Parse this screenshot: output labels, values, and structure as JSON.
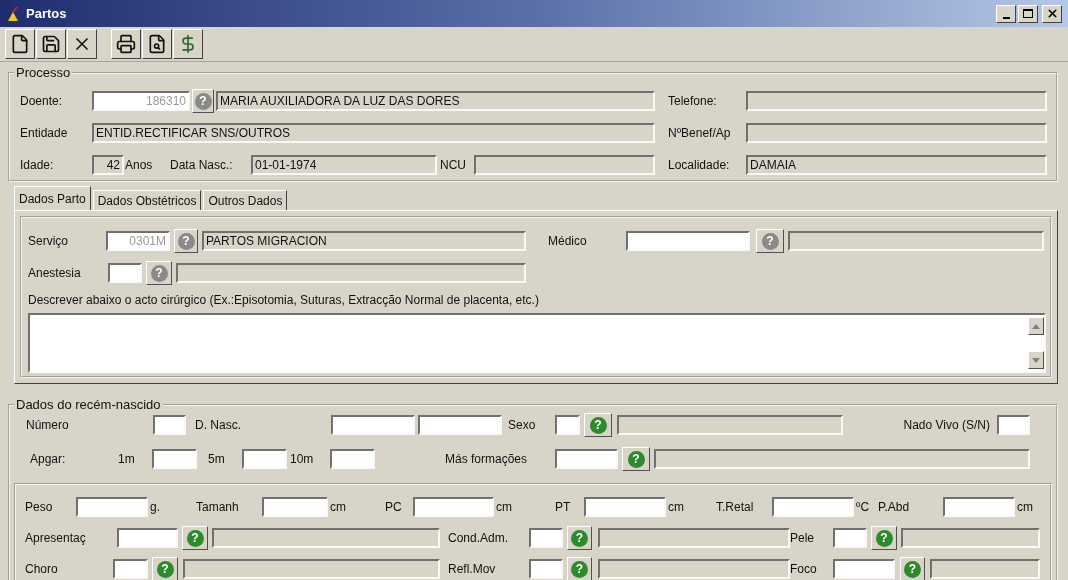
{
  "window": {
    "title": "Partos"
  },
  "toolbar": [
    {
      "kind": "new"
    },
    {
      "kind": "save"
    },
    {
      "kind": "delete"
    },
    {
      "kind": "print"
    },
    {
      "kind": "preview"
    },
    {
      "kind": "currency"
    }
  ],
  "processo": {
    "title": "Processo",
    "fields": [
      {
        "kind": "label",
        "text": "Doente:"
      },
      {
        "kind": "input",
        "value": "186310",
        "disabled": true
      },
      {
        "kind": "lookup",
        "symbol": "?",
        "disabled": true
      },
      {
        "kind": "display",
        "value": "MARIA AUXILIADORA DA LUZ DAS DORES"
      },
      {
        "kind": "label",
        "text": "Telefone:"
      },
      {
        "kind": "display"
      },
      {
        "kind": "label",
        "text": "Entidade"
      },
      {
        "kind": "display",
        "value": "ENTID.RECTIFICAR SNS/OUTROS"
      },
      {
        "kind": "label",
        "text": "NºBenef/Ap"
      },
      {
        "kind": "display"
      },
      {
        "kind": "label",
        "text": "Idade:"
      },
      {
        "kind": "display",
        "value": "42"
      },
      {
        "kind": "label",
        "text": "Anos"
      },
      {
        "kind": "label",
        "text": "Data Nasc.:"
      },
      {
        "kind": "display",
        "value": "01-01-1974"
      },
      {
        "kind": "label",
        "text": "NCU"
      },
      {
        "kind": "display"
      },
      {
        "kind": "label",
        "text": "Localidade:"
      },
      {
        "kind": "display",
        "value": "DAMAIA"
      }
    ]
  },
  "tabs": [
    {
      "label": "Dados Parto",
      "selected": true
    },
    {
      "label": "Dados Obstétricos",
      "selected": false
    },
    {
      "label": "Outros Dados",
      "selected": false
    }
  ],
  "tab_panel": {
    "fields": [
      {
        "kind": "label",
        "text": "Serviço"
      },
      {
        "kind": "input",
        "value": "0301M",
        "disabled": true
      },
      {
        "kind": "lookup",
        "symbol": "?",
        "disabled": true
      },
      {
        "kind": "display",
        "value": "PARTOS MIGRACION"
      },
      {
        "kind": "label",
        "text": "Médico"
      },
      {
        "kind": "input"
      },
      {
        "kind": "lookup",
        "symbol": "?",
        "disabled": true
      },
      {
        "kind": "display"
      },
      {
        "kind": "label",
        "text": "Anestesia"
      },
      {
        "kind": "input"
      },
      {
        "kind": "lookup",
        "symbol": "?",
        "disabled": true
      },
      {
        "kind": "display"
      }
    ],
    "note": "Descrever abaixo o acto cirúrgico (Ex.:Episotomia, Suturas, Extracção Normal de placenta, etc.)"
  },
  "newborn": {
    "title": "Dados do recém-nascido",
    "fields": [
      {
        "kind": "label",
        "text": "Número"
      },
      {
        "kind": "input"
      },
      {
        "kind": "label",
        "text": "D. Nasc."
      },
      {
        "kind": "input"
      },
      {
        "kind": "input"
      },
      {
        "kind": "label",
        "text": "Sexo"
      },
      {
        "kind": "input"
      },
      {
        "kind": "lookup",
        "symbol": "?",
        "disabled": false
      },
      {
        "kind": "display"
      },
      {
        "kind": "label",
        "text": "Nado Vivo (S/N)"
      },
      {
        "kind": "input"
      },
      {
        "kind": "label",
        "text": "Apgar:"
      },
      {
        "kind": "label",
        "text": "1m"
      },
      {
        "kind": "input"
      },
      {
        "kind": "label",
        "text": "5m"
      },
      {
        "kind": "input"
      },
      {
        "kind": "label",
        "text": "10m"
      },
      {
        "kind": "input"
      },
      {
        "kind": "label",
        "text": "Más formações"
      },
      {
        "kind": "input"
      },
      {
        "kind": "lookup",
        "symbol": "?",
        "disabled": false
      },
      {
        "kind": "display"
      }
    ],
    "inner_fields": [
      {
        "kind": "label",
        "text": "Peso"
      },
      {
        "kind": "input"
      },
      {
        "kind": "label",
        "text": "g."
      },
      {
        "kind": "label",
        "text": "Tamanh"
      },
      {
        "kind": "input"
      },
      {
        "kind": "label",
        "text": "cm"
      },
      {
        "kind": "label",
        "text": "PC"
      },
      {
        "kind": "input"
      },
      {
        "kind": "label",
        "text": "cm"
      },
      {
        "kind": "label",
        "text": "PT"
      },
      {
        "kind": "input"
      },
      {
        "kind": "label",
        "text": "cm"
      },
      {
        "kind": "label",
        "text": "T.Retal"
      },
      {
        "kind": "input"
      },
      {
        "kind": "label",
        "text": "ºC"
      },
      {
        "kind": "label",
        "text": "P.Abd"
      },
      {
        "kind": "input"
      },
      {
        "kind": "label",
        "text": "cm"
      },
      {
        "kind": "label",
        "text": "Apresentaç"
      },
      {
        "kind": "input"
      },
      {
        "kind": "lookup",
        "symbol": "?",
        "disabled": false
      },
      {
        "kind": "display"
      },
      {
        "kind": "label",
        "text": "Cond.Adm."
      },
      {
        "kind": "input"
      },
      {
        "kind": "lookup",
        "symbol": "?",
        "disabled": false
      },
      {
        "kind": "display"
      },
      {
        "kind": "label",
        "text": "Pele"
      },
      {
        "kind": "input"
      },
      {
        "kind": "lookup",
        "symbol": "?",
        "disabled": false
      },
      {
        "kind": "display"
      },
      {
        "kind": "label",
        "text": "Choro"
      },
      {
        "kind": "input"
      },
      {
        "kind": "lookup",
        "symbol": "?",
        "disabled": false
      },
      {
        "kind": "display"
      },
      {
        "kind": "label",
        "text": "Refl.Mov"
      },
      {
        "kind": "input"
      },
      {
        "kind": "lookup",
        "symbol": "?",
        "disabled": false
      },
      {
        "kind": "display"
      },
      {
        "kind": "label",
        "text": "Foco"
      },
      {
        "kind": "input"
      },
      {
        "kind": "lookup",
        "symbol": "?",
        "disabled": false
      },
      {
        "kind": "display"
      }
    ]
  }
}
